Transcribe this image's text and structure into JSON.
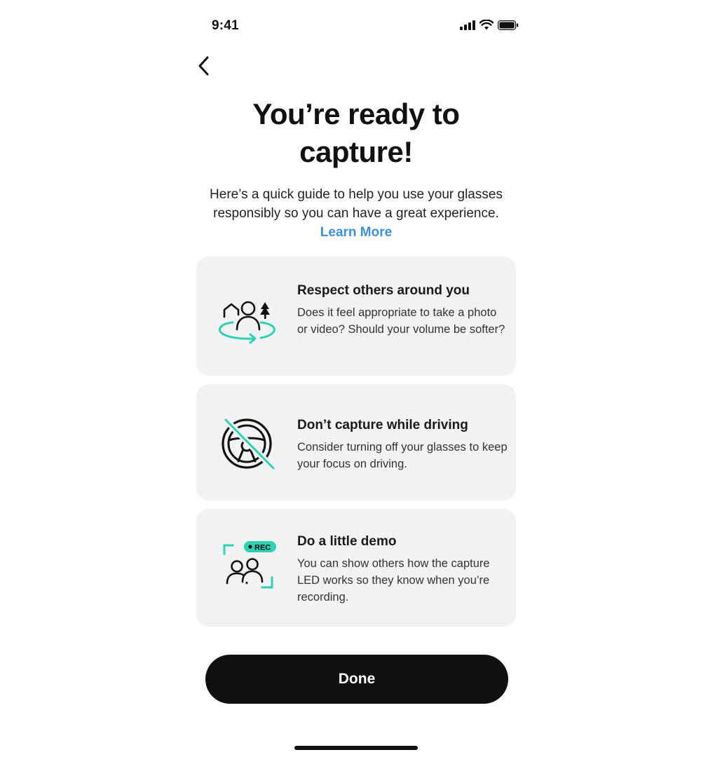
{
  "status_bar": {
    "time": "9:41",
    "icons": [
      "cellular-signal-icon",
      "wifi-icon",
      "battery-icon"
    ]
  },
  "nav": {
    "back_icon": "chevron-left-icon"
  },
  "header": {
    "title": "You’re ready to capture!",
    "subtitle": "Here’s a quick guide to help you use your glasses responsibly so you can have a great experience.",
    "learn_more": "Learn More"
  },
  "cards": [
    {
      "icon": "people-surroundings-icon",
      "title": "Respect others around you",
      "body": "Does it feel appropriate to take a photo or video? Should your volume be softer?"
    },
    {
      "icon": "no-driving-steering-wheel-icon",
      "title": "Don’t capture while driving",
      "body": "Consider turning off your glasses to keep your focus on driving."
    },
    {
      "icon": "recording-demo-icon",
      "title": "Do a little demo",
      "body": "You can show others how the capture LED works so they know when you’re recording.",
      "badge": "REC"
    }
  ],
  "footer": {
    "done_label": "Done"
  },
  "colors": {
    "accent_teal": "#2fd1b0",
    "link_blue": "#3d8fd8",
    "card_bg": "#f1f2f4",
    "button_bg": "#111111"
  }
}
